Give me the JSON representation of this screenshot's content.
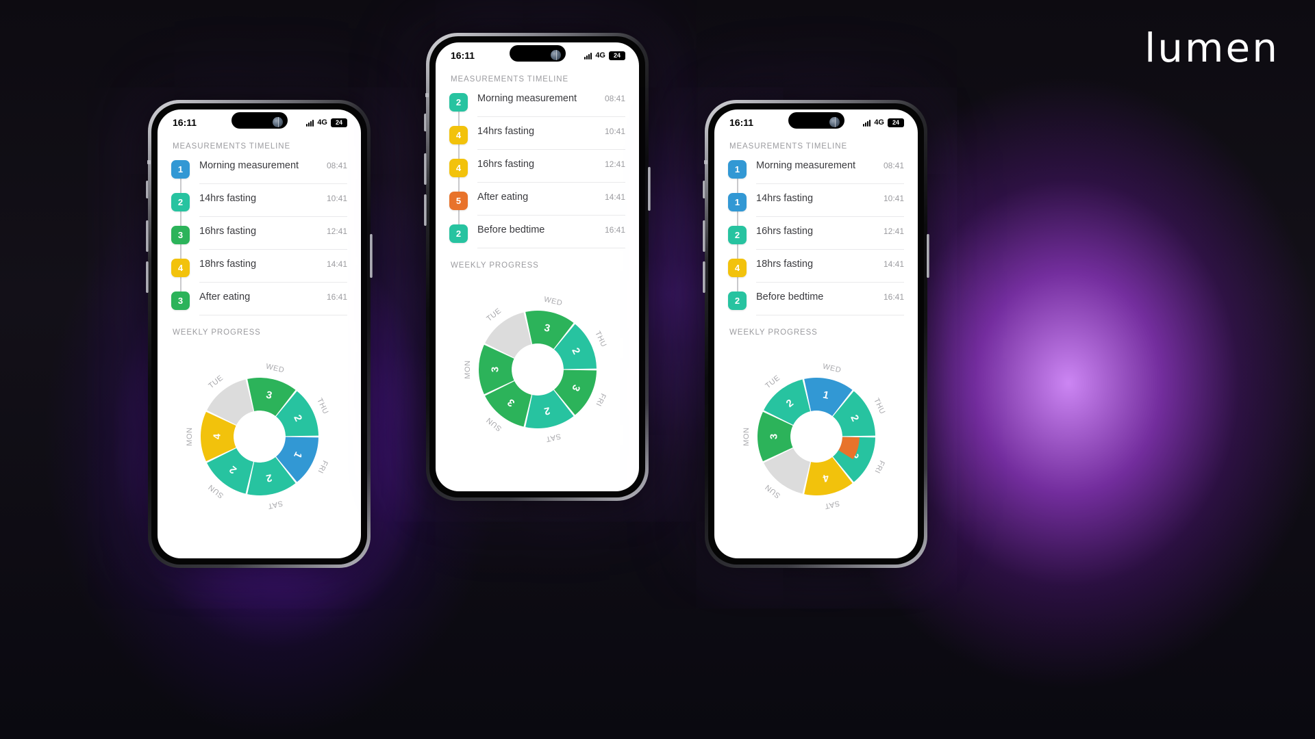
{
  "brand": {
    "logo_text": "lumen"
  },
  "colors": {
    "blue": "#3298d4",
    "teal": "#27c3a0",
    "green": "#2cb35a",
    "yellow": "#f2c20c",
    "orange": "#e8732b",
    "grey": "#dcdcdc",
    "text_dark": "#3a3a3e",
    "text_muted": "#9b9b9f"
  },
  "status_bar": {
    "time": "16:11",
    "network": "4G",
    "battery": "24",
    "face_icon": "face-id-icon",
    "signal_icon": "signal-bars-icon"
  },
  "sections": {
    "timeline_title": "MEASUREMENTS TIMELINE",
    "progress_title": "WEEKLY PROGRESS"
  },
  "phones": [
    {
      "id": "phone-left",
      "timeline": [
        {
          "badge": "1",
          "color": "#3298d4",
          "label": "Morning measurement",
          "time": "08:41"
        },
        {
          "badge": "2",
          "color": "#27c3a0",
          "label": "14hrs fasting",
          "time": "10:41"
        },
        {
          "badge": "3",
          "color": "#2cb35a",
          "label": "16hrs fasting",
          "time": "12:41"
        },
        {
          "badge": "4",
          "color": "#f2c20c",
          "label": "18hrs fasting",
          "time": "14:41"
        },
        {
          "badge": "3",
          "color": "#2cb35a",
          "label": "After eating",
          "time": "16:41"
        }
      ],
      "chart_data": {
        "type": "pie",
        "title": "WEEKLY PROGRESS",
        "variant": "donut",
        "categories": [
          "MON",
          "TUE",
          "WED",
          "THU",
          "FRI",
          "SAT",
          "SUN"
        ],
        "values": [
          4,
          0,
          3,
          2,
          1,
          2,
          2
        ],
        "labels": [
          "4",
          "",
          "3",
          "2",
          "1",
          "2",
          "2"
        ],
        "colors": [
          "#f2c20c",
          "#dcdcdc",
          "#2cb35a",
          "#27c3a0",
          "#3298d4",
          "#27c3a0",
          "#27c3a0"
        ],
        "legend": "radial-day-labels",
        "grid": false
      }
    },
    {
      "id": "phone-center",
      "timeline": [
        {
          "badge": "2",
          "color": "#27c3a0",
          "label": "Morning measurement",
          "time": "08:41"
        },
        {
          "badge": "4",
          "color": "#f2c20c",
          "label": "14hrs fasting",
          "time": "10:41"
        },
        {
          "badge": "4",
          "color": "#f2c20c",
          "label": "16hrs fasting",
          "time": "12:41"
        },
        {
          "badge": "5",
          "color": "#e8732b",
          "label": "After eating",
          "time": "14:41"
        },
        {
          "badge": "2",
          "color": "#27c3a0",
          "label": "Before bedtime",
          "time": "16:41"
        }
      ],
      "chart_data": {
        "type": "pie",
        "title": "WEEKLY PROGRESS",
        "variant": "donut",
        "categories": [
          "MON",
          "TUE",
          "WED",
          "THU",
          "FRI",
          "SAT",
          "SUN"
        ],
        "values": [
          3,
          0,
          3,
          2,
          3,
          2,
          3
        ],
        "labels": [
          "3",
          "",
          "3",
          "2",
          "3",
          "2",
          "3"
        ],
        "colors": [
          "#2cb35a",
          "#dcdcdc",
          "#2cb35a",
          "#27c3a0",
          "#2cb35a",
          "#27c3a0",
          "#2cb35a"
        ],
        "legend": "radial-day-labels",
        "grid": false
      }
    },
    {
      "id": "phone-right",
      "timeline": [
        {
          "badge": "1",
          "color": "#3298d4",
          "label": "Morning measurement",
          "time": "08:41"
        },
        {
          "badge": "1",
          "color": "#3298d4",
          "label": "14hrs fasting",
          "time": "10:41"
        },
        {
          "badge": "2",
          "color": "#27c3a0",
          "label": "16hrs fasting",
          "time": "12:41"
        },
        {
          "badge": "4",
          "color": "#f2c20c",
          "label": "18hrs fasting",
          "time": "14:41"
        },
        {
          "badge": "2",
          "color": "#27c3a0",
          "label": "Before bedtime",
          "time": "16:41"
        }
      ],
      "chart_data": {
        "type": "pie",
        "title": "WEEKLY PROGRESS",
        "variant": "donut",
        "categories": [
          "MON",
          "TUE",
          "WED",
          "THU",
          "FRI",
          "SAT",
          "SUN"
        ],
        "values": [
          3,
          2,
          1,
          2,
          2,
          4,
          0
        ],
        "labels": [
          "3",
          "2",
          "1",
          "2",
          "2",
          "4",
          ""
        ],
        "colors": [
          "#2cb35a",
          "#27c3a0",
          "#3298d4",
          "#27c3a0",
          "#27c3a0",
          "#f2c20c",
          "#dcdcdc"
        ],
        "extra_segment": {
          "color": "#e8732b",
          "between": [
            "FRI",
            "THU"
          ]
        },
        "legend": "radial-day-labels",
        "grid": false
      }
    }
  ]
}
